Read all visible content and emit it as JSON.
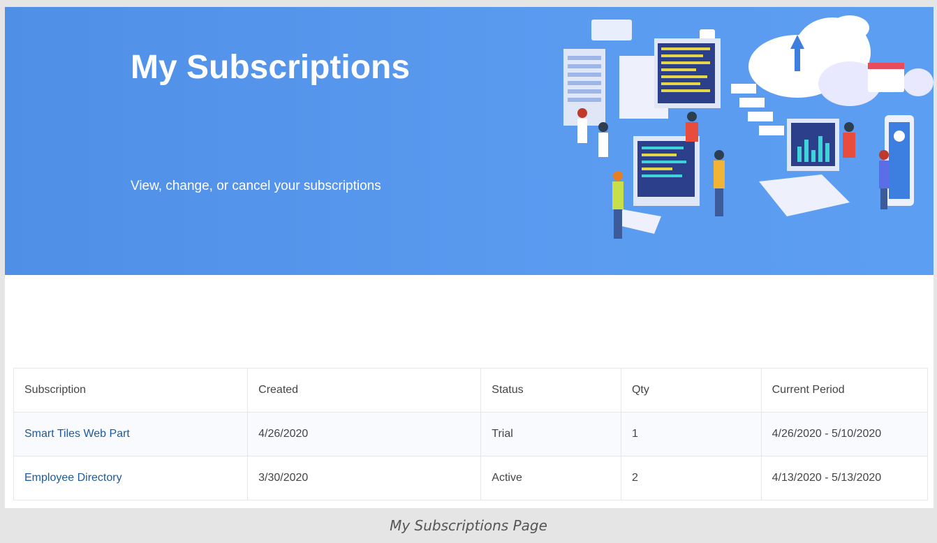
{
  "hero": {
    "title": "My Subscriptions",
    "subtitle": "View, change, or cancel your subscriptions",
    "background_color": "#5a9bf0",
    "illustration": "isometric-tech-illustration"
  },
  "table": {
    "headers": [
      "Subscription",
      "Created",
      "Status",
      "Qty",
      "Current Period"
    ],
    "rows": [
      {
        "subscription": "Smart Tiles Web Part",
        "created": "4/26/2020",
        "status": "Trial",
        "qty": "1",
        "period": "4/26/2020 - 5/10/2020"
      },
      {
        "subscription": "Employee Directory",
        "created": "3/30/2020",
        "status": "Active",
        "qty": "2",
        "period": "4/13/2020 - 5/13/2020"
      }
    ],
    "link_color": "#1c5aa0"
  },
  "caption": "My Subscriptions Page"
}
